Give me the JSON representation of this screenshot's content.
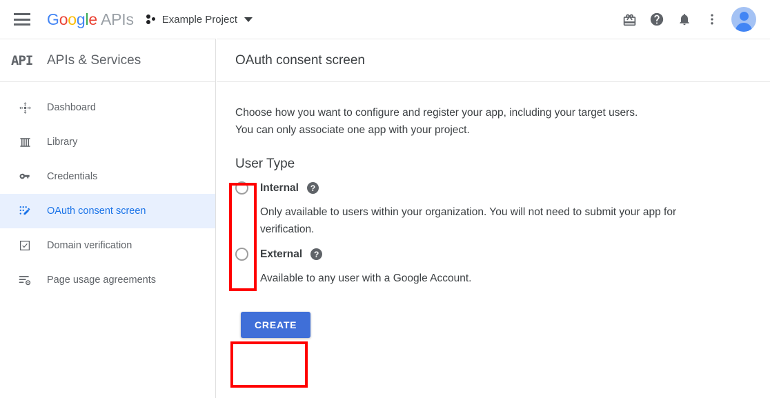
{
  "topbar": {
    "menu_icon": "hamburger-menu-icon",
    "brand": {
      "google": "Google",
      "letters": [
        "G",
        "o",
        "o",
        "g",
        "l",
        "e"
      ],
      "apis": "APIs"
    },
    "project": {
      "name": "Example Project",
      "icon": "project-dots-icon",
      "caret": "chevron-down-icon"
    },
    "icons": [
      {
        "name": "gift-icon",
        "glyph": "🎁"
      },
      {
        "name": "help-icon",
        "glyph": "?"
      },
      {
        "name": "notifications-bell-icon",
        "glyph": "🔔"
      },
      {
        "name": "more-vert-icon",
        "glyph": "⋮"
      }
    ],
    "avatar_label": "account-avatar"
  },
  "sidebar": {
    "logo_text": "API",
    "title": "APIs & Services",
    "items": [
      {
        "label": "Dashboard",
        "icon": "dashboard-icon",
        "active": false
      },
      {
        "label": "Library",
        "icon": "library-icon",
        "active": false
      },
      {
        "label": "Credentials",
        "icon": "key-icon",
        "active": false
      },
      {
        "label": "OAuth consent screen",
        "icon": "oauth-consent-icon",
        "active": true
      },
      {
        "label": "Domain verification",
        "icon": "domain-verification-icon",
        "active": false
      },
      {
        "label": "Page usage agreements",
        "icon": "page-usage-agreements-icon",
        "active": false
      }
    ]
  },
  "main": {
    "title": "OAuth consent screen",
    "intro": "Choose how you want to configure and register your app, including your target users. You can only associate one app with your project.",
    "section_title": "User Type",
    "options": [
      {
        "label": "Internal",
        "help": "?",
        "description": "Only available to users within your organization. You will not need to submit your app for verification.",
        "selected": false
      },
      {
        "label": "External",
        "help": "?",
        "description": "Available to any user with a Google Account.",
        "selected": false
      }
    ],
    "create_button": "CREATE"
  },
  "annotations": {
    "radio_box": "highlight-radio-options",
    "create_box": "highlight-create-button",
    "color": "#FF0000"
  },
  "colors": {
    "accent_blue": "#1a73e8",
    "button_blue": "#3f6fd8",
    "active_bg": "#e8f0fe",
    "text": "#3c4043",
    "muted": "#5f6368",
    "annotation_red": "#FF0000"
  }
}
